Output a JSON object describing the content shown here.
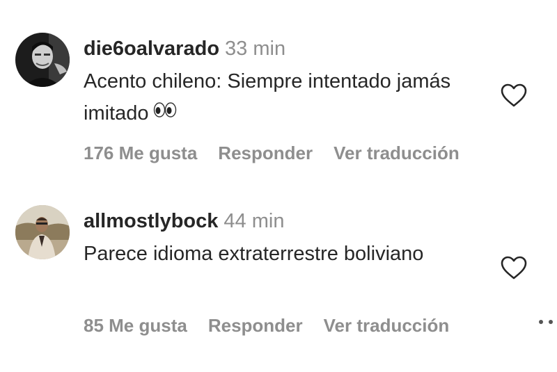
{
  "comments": [
    {
      "username": "die6oalvarado",
      "time": "33 min",
      "text": "Acento chileno: Siempre intentado jamás imitado",
      "emoji": "👀",
      "likes": "176 Me gusta",
      "reply": "Responder",
      "translate": "Ver traducción",
      "avatar_icon": "profile-photo"
    },
    {
      "username": "allmostlybock",
      "time": "44 min",
      "text": "Parece idioma extraterrestre boliviano",
      "likes": "85 Me gusta",
      "reply": "Responder",
      "translate": "Ver traducción",
      "avatar_icon": "profile-photo"
    }
  ],
  "icons": {
    "like": "heart-icon",
    "more": "more-options-icon"
  }
}
